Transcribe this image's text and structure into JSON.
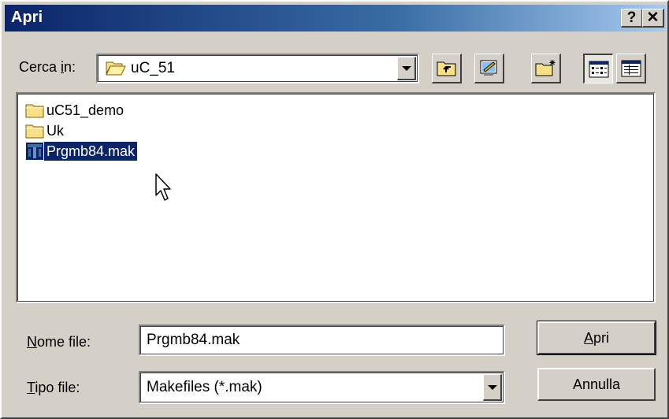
{
  "window": {
    "title": "Apri",
    "help_label": "?",
    "close_label": "✕"
  },
  "look_in": {
    "label_prefix": "Cerca ",
    "label_accel": "i",
    "label_suffix": "n:",
    "value": "uC_51"
  },
  "toolbar": {
    "buttons": [
      "up-one-level",
      "desktop",
      "new-folder",
      "list-view",
      "details-view"
    ],
    "pressed": "list-view"
  },
  "files": [
    {
      "name": "uC51_demo",
      "type": "folder"
    },
    {
      "name": "Uk",
      "type": "folder"
    },
    {
      "name": "Prgmb84.mak",
      "type": "makefile",
      "selected": true
    }
  ],
  "filename": {
    "label_accel": "N",
    "label_rest": "ome file:",
    "value": "Prgmb84.mak"
  },
  "filetype": {
    "label_accel": "T",
    "label_rest": "ipo file:",
    "value": "Makefiles (*.mak)"
  },
  "buttons": {
    "open_accel": "A",
    "open_rest": "pri",
    "cancel": "Annulla"
  },
  "colors": {
    "title_bar": "#0a246a",
    "face": "#d4d0c8",
    "selection": "#0a246a",
    "folder": "#f8e089"
  }
}
